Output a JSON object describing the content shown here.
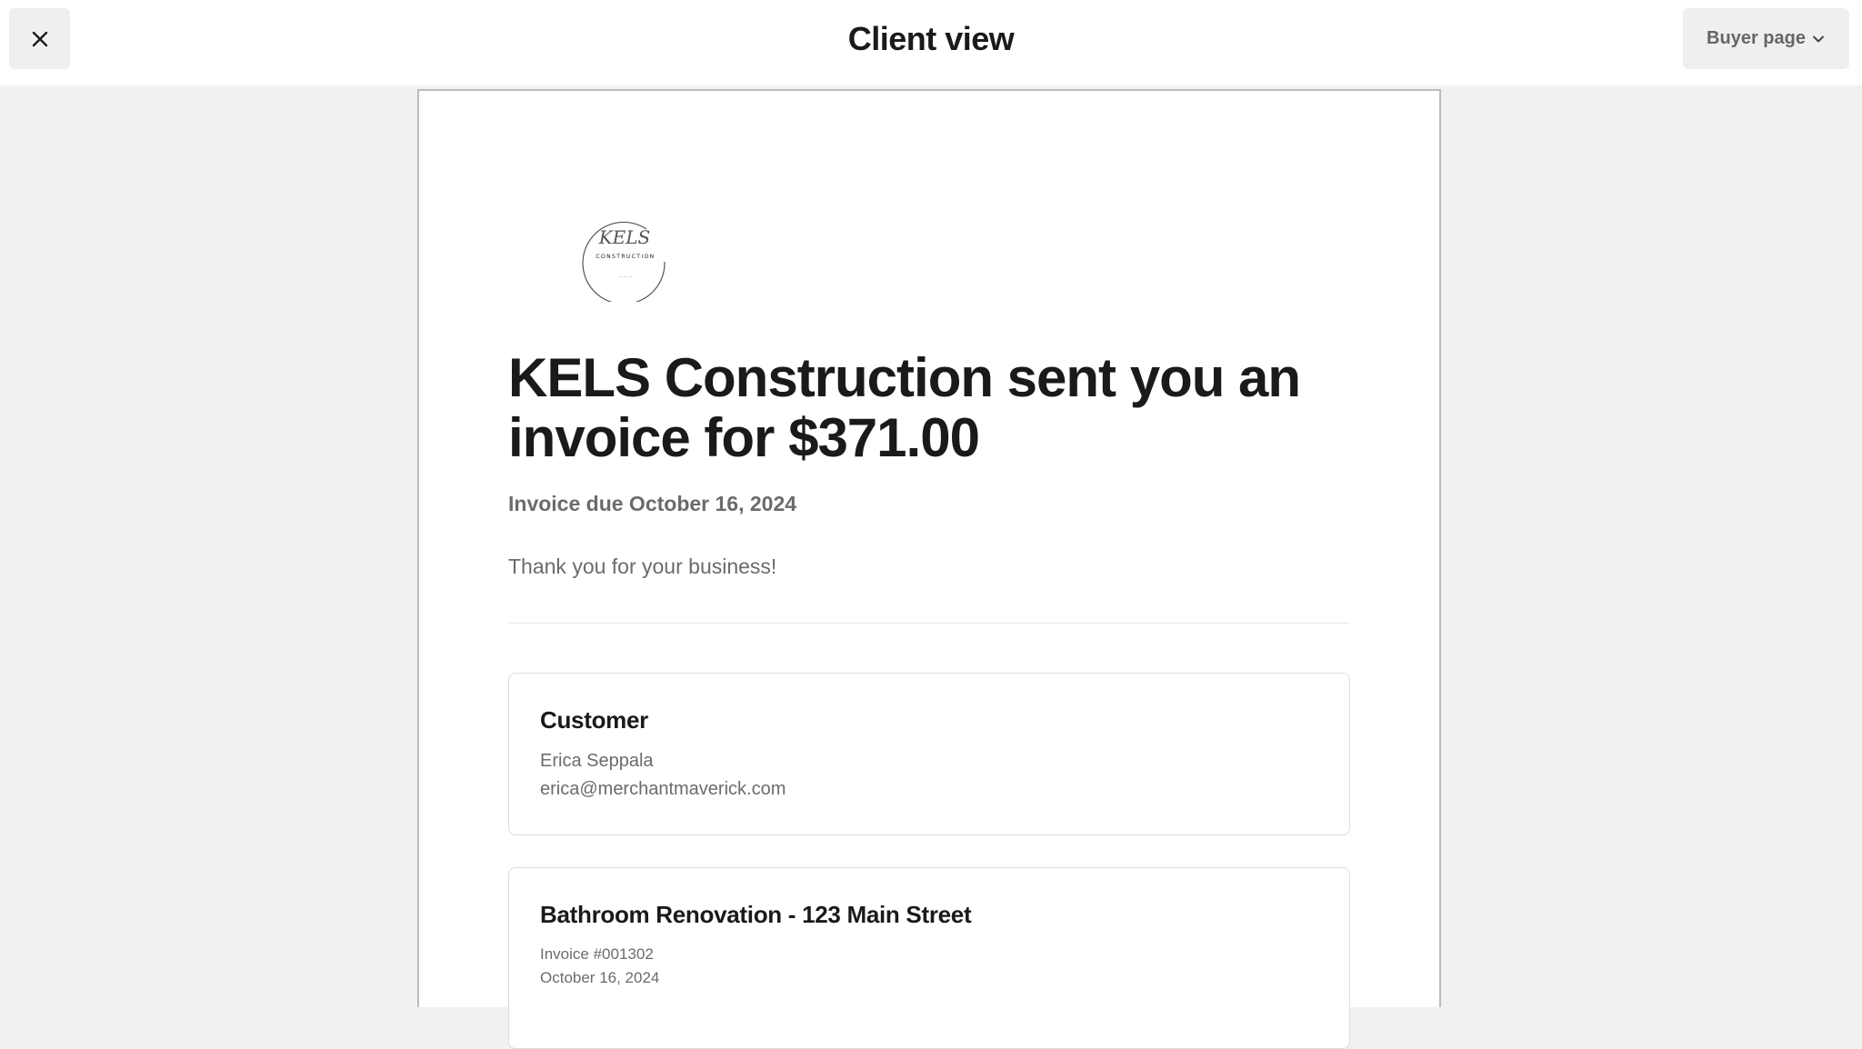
{
  "header": {
    "title": "Client view",
    "close_icon": "close-icon",
    "buyer_page_label": "Buyer page",
    "buyer_page_icon": "chevron-down-icon"
  },
  "invoice": {
    "logo": {
      "brand": "KELS",
      "subtitle": "CONSTRUCTION",
      "tagline": "— — —"
    },
    "headline": "KELS Construction sent you an invoice for $371.00",
    "due": "Invoice due October 16, 2024",
    "message": "Thank you for your business!",
    "customer": {
      "heading": "Customer",
      "name": "Erica Seppala",
      "email": "erica@merchantmaverick.com"
    },
    "project": {
      "heading": "Bathroom Renovation - 123 Main Street",
      "number": "Invoice #001302",
      "date": "October 16, 2024"
    }
  }
}
